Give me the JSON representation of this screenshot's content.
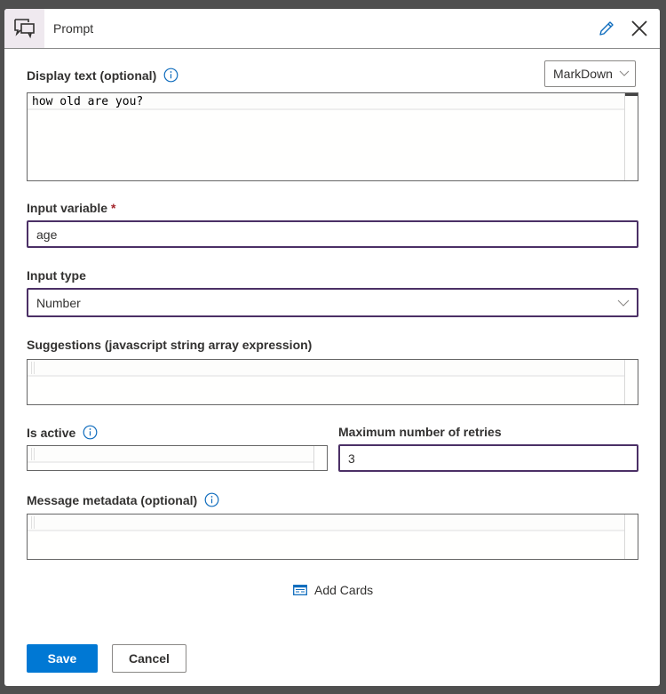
{
  "header": {
    "title": "Prompt",
    "icon": "chat-bubbles-icon",
    "edit_icon": "pencil-icon",
    "close_icon": "close-icon"
  },
  "display_text": {
    "label": "Display text (optional)",
    "format_select": "MarkDown",
    "value": "how old are you?"
  },
  "input_variable": {
    "label": "Input variable",
    "required_mark": "*",
    "value": "age"
  },
  "input_type": {
    "label": "Input type",
    "value": "Number"
  },
  "suggestions": {
    "label": "Suggestions (javascript string array expression)",
    "value": ""
  },
  "is_active": {
    "label": "Is active",
    "value": ""
  },
  "max_retries": {
    "label": "Maximum number of retries",
    "value": "3"
  },
  "message_metadata": {
    "label": "Message metadata (optional)",
    "value": ""
  },
  "add_cards": {
    "label": "Add Cards",
    "icon": "card-icon"
  },
  "footer": {
    "save_label": "Save",
    "cancel_label": "Cancel"
  },
  "colors": {
    "primary": "#0078d4",
    "focus_border": "#4b3066",
    "required": "#a4262c",
    "info_icon": "#0f6cbd"
  }
}
